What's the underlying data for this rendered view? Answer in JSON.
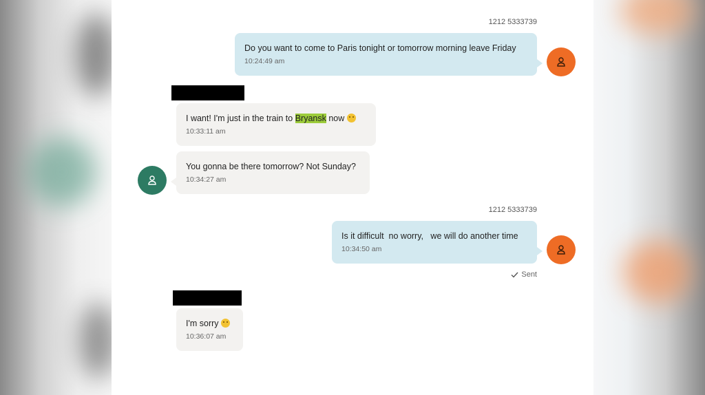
{
  "colors": {
    "outgoing_bubble": "#d3e9f0",
    "incoming_bubble": "#f3f2f0",
    "outgoing_avatar": "#ee6c25",
    "incoming_avatar": "#2d7b63",
    "highlight": "#9ccc3a",
    "redaction": "#000000"
  },
  "messages": [
    {
      "direction": "outgoing",
      "sender": "1212 5333739",
      "text": "Do you want to come to Paris tonight or tomorrow morning leave Friday",
      "time": "10:24:49 am",
      "avatar_icon": "person-icon"
    },
    {
      "direction": "incoming",
      "sender_redacted": true,
      "text_before": "I want! I'm just in the train to ",
      "highlighted": "Bryansk",
      "text_after": " now",
      "emoji": "pensive-face-emoji",
      "time": "10:33:11 am"
    },
    {
      "direction": "incoming",
      "text": "You gonna be there tomorrow? Not Sunday?",
      "time": "10:34:27 am",
      "avatar_icon": "person-icon"
    },
    {
      "direction": "outgoing",
      "sender": "1212 5333739",
      "text": "Is it difficult  no worry,   we will do another time",
      "time": "10:34:50 am",
      "avatar_icon": "person-icon",
      "status": "Sent"
    },
    {
      "direction": "incoming",
      "sender_redacted": true,
      "text": "I'm sorry",
      "emoji": "pensive-face-emoji",
      "time": "10:36:07 am"
    }
  ]
}
